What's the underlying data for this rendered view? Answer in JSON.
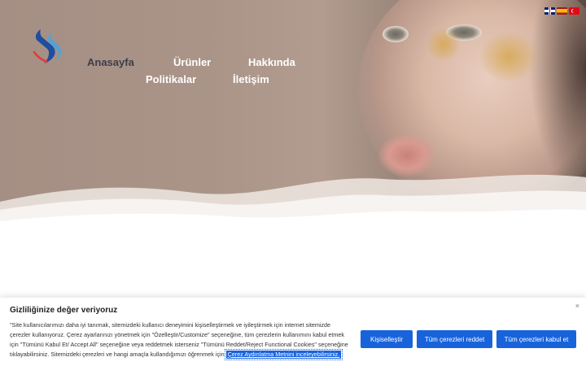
{
  "nav": {
    "home": "Anasayfa",
    "products": "Ürünler",
    "about": "Hakkında",
    "policies": "Politikalar",
    "contact": "İletişim"
  },
  "languages": [
    {
      "code": "en",
      "icon": "uk-flag-icon"
    },
    {
      "code": "es",
      "icon": "spain-flag-icon"
    },
    {
      "code": "tr",
      "icon": "turkey-flag-icon"
    }
  ],
  "logo": {
    "icon": "brand-s-logo-icon",
    "colors": [
      "#1f4e9c",
      "#e53935",
      "#4fa3d9"
    ]
  },
  "cookie": {
    "title": "Gizliliğinize değer veriyoruz",
    "text": "\"Site kullanıcılarımızı daha iyi tanımak, sitemizdeki kullanıcı deneyimini kişiselleştirmek ve iyileştirmek için internet sitemizde çerezler kullanıyoruz. Çerez ayarlarınızı yönetmek için \"Özelleştir/Customize\" seçeneğine, tüm çerezlerin kullanımını kabul etmek için \"Tümünü Kabul Et/ Accept All\" seçeneğine veya reddetmek isterseniz \"Tümünü Reddet/Reject Functional Cookies\" seçeneğine tıklayabilirsiniz. Sitemizdeki çerezleri ve hangi amaçla kullandığımızı öğrenmek için",
    "link": "Çerez Aydınlatma Metnini inceleyebilirsiniz.",
    "close": "×",
    "customize": "Kişiselleştir",
    "reject": "Tüm çerezleri reddet",
    "accept": "Tüm çerezleri kabul et",
    "button_color": "#1863dc"
  }
}
